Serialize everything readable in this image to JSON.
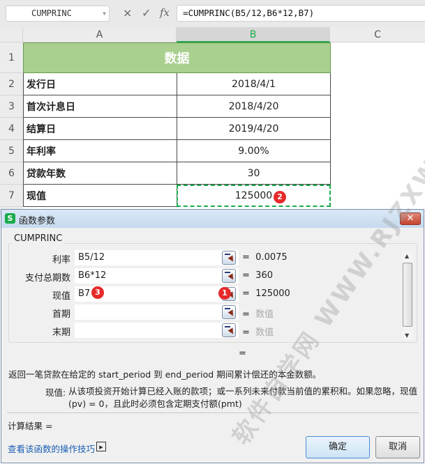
{
  "formula_bar": {
    "name_box": "CUMPRINC",
    "cancel_icon": "×",
    "enter_icon": "✓",
    "fx_label": "fx",
    "formula": "=CUMPRINC(B5/12,B6*12,B7)"
  },
  "columns": [
    "A",
    "B",
    "C"
  ],
  "rows": [
    {
      "num": "1",
      "a": "数据",
      "b": ""
    },
    {
      "num": "2",
      "a": "发行日",
      "b": "2018/4/1"
    },
    {
      "num": "3",
      "a": "首次计息日",
      "b": "2018/4/20"
    },
    {
      "num": "4",
      "a": "结算日",
      "b": "2019/4/20"
    },
    {
      "num": "5",
      "a": "年利率",
      "b": "9.00%"
    },
    {
      "num": "6",
      "a": "贷款年数",
      "b": "30"
    },
    {
      "num": "7",
      "a": "现值",
      "b": "125000"
    }
  ],
  "badges": [
    "1",
    "2",
    "3"
  ],
  "dialog": {
    "title": "函数参数",
    "app_icon": "S",
    "close_icon": "✕",
    "function_name": "CUMPRINC",
    "args": [
      {
        "label": "利率",
        "value": "B5/12",
        "result": "0.0075"
      },
      {
        "label": "支付总期数",
        "value": "B6*12",
        "result": "360"
      },
      {
        "label": "现值",
        "value": "B7",
        "result": "125000"
      },
      {
        "label": "首期",
        "value": "",
        "result": "数值"
      },
      {
        "label": "末期",
        "value": "",
        "result": "数值"
      }
    ],
    "eq": "=",
    "formula_result_eq": "=",
    "description": "返回一笔贷款在给定的 start_period 到 end_period 期间累计偿还的本金数额。",
    "arg_help_label": "现值:",
    "arg_help": "从该项投资开始计算已经入账的款项；或一系列未来付款当前值的累积和。如果忽略，现值 (pv) = 0，且此时必须包含定期支付额(pmt)",
    "calc_result_label": "计算结果 =",
    "help_link": "查看该函数的操作技巧",
    "ok": "确定",
    "cancel": "取消"
  },
  "watermark": "软件自学网 WWW.RJZXW.COM",
  "colors": {
    "header_green": "#a9d08e",
    "accent": "#1aab4a",
    "link": "#1a5fb4",
    "badge": "#e62a2a"
  }
}
